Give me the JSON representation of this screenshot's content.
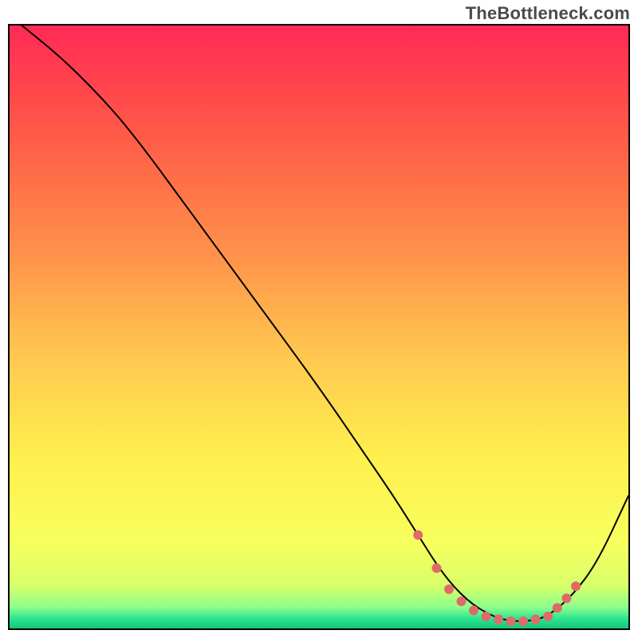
{
  "watermark": "TheBottleneck.com",
  "chart_data": {
    "type": "line",
    "title": "",
    "xlabel": "",
    "ylabel": "",
    "xlim": [
      0,
      100
    ],
    "ylim": [
      0,
      100
    ],
    "legend": false,
    "grid": false,
    "background_gradient": {
      "stops": [
        {
          "offset": 0.0,
          "color": "#ff2a55"
        },
        {
          "offset": 0.18,
          "color": "#ff5a47"
        },
        {
          "offset": 0.38,
          "color": "#ff924a"
        },
        {
          "offset": 0.55,
          "color": "#ffc84f"
        },
        {
          "offset": 0.72,
          "color": "#fff04e"
        },
        {
          "offset": 0.86,
          "color": "#f7ff5e"
        },
        {
          "offset": 0.93,
          "color": "#d6ff6a"
        },
        {
          "offset": 0.965,
          "color": "#8cff8c"
        },
        {
          "offset": 0.985,
          "color": "#27e38f"
        },
        {
          "offset": 1.0,
          "color": "#15c67a"
        }
      ]
    },
    "series": [
      {
        "name": "bottleneck-curve",
        "stroke": "#000000",
        "stroke_width": 2,
        "x": [
          2,
          8,
          14,
          20,
          30,
          40,
          50,
          58,
          62,
          66,
          70,
          74,
          78,
          81,
          84,
          87,
          91,
          95,
          100
        ],
        "y": [
          100,
          95,
          89,
          82,
          68,
          54,
          40,
          28,
          22,
          15.5,
          9,
          4.5,
          2,
          1.2,
          1.2,
          2,
          5.5,
          11,
          22
        ]
      }
    ],
    "markers": {
      "name": "sweet-spot-dots",
      "shape": "circle",
      "color": "#e06a6a",
      "radius": 6,
      "points": [
        {
          "x": 66,
          "y": 15.5
        },
        {
          "x": 69,
          "y": 10
        },
        {
          "x": 71,
          "y": 6.5
        },
        {
          "x": 73,
          "y": 4.5
        },
        {
          "x": 75,
          "y": 3
        },
        {
          "x": 77,
          "y": 2
        },
        {
          "x": 79,
          "y": 1.5
        },
        {
          "x": 81,
          "y": 1.2
        },
        {
          "x": 83,
          "y": 1.2
        },
        {
          "x": 85,
          "y": 1.5
        },
        {
          "x": 87,
          "y": 2
        },
        {
          "x": 88.5,
          "y": 3.4
        },
        {
          "x": 90,
          "y": 5
        },
        {
          "x": 91.5,
          "y": 7
        }
      ]
    }
  }
}
